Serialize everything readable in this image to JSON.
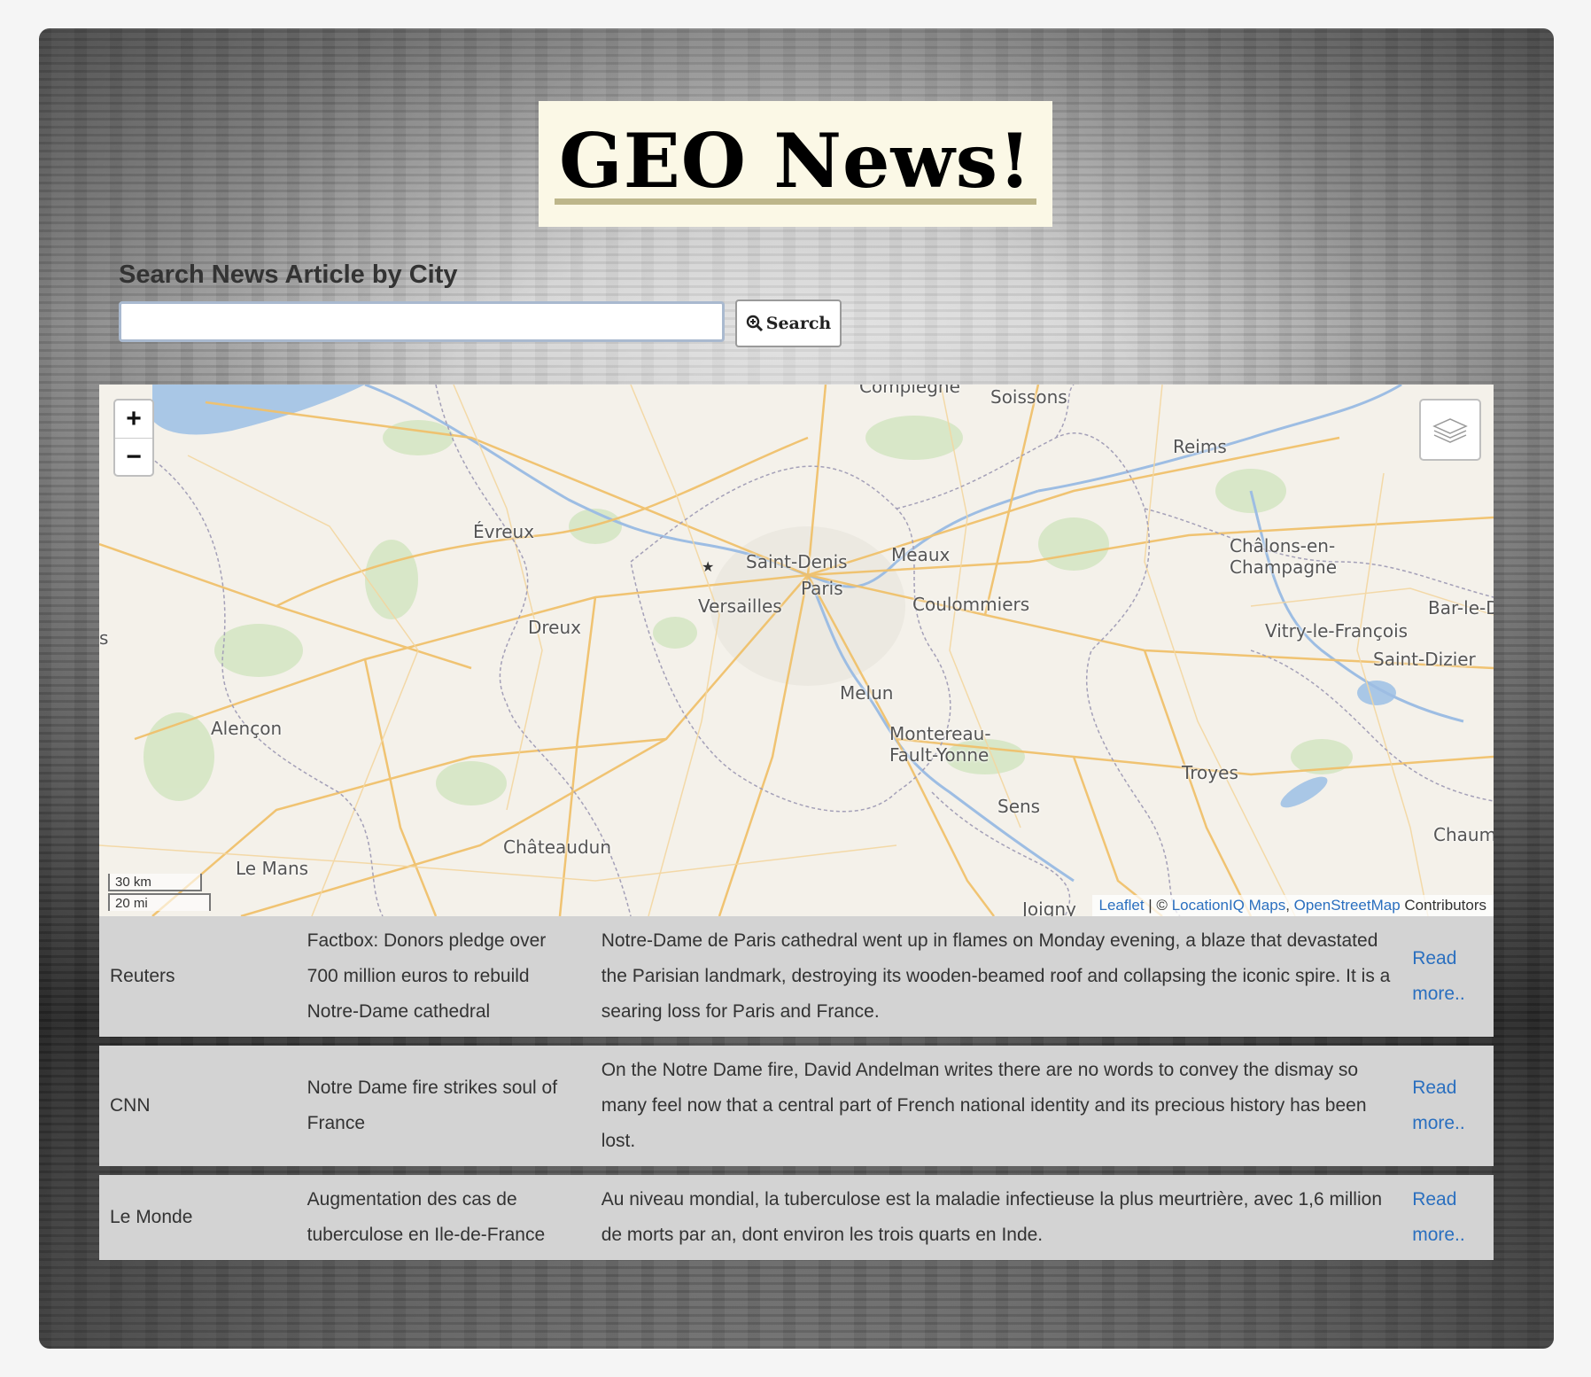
{
  "header": {
    "title": "GEO News!"
  },
  "search": {
    "label": "Search News Article by City",
    "value": "",
    "placeholder": "",
    "button_label": "Search"
  },
  "map": {
    "zoom_in": "+",
    "zoom_out": "−",
    "scale_km": "30 km",
    "scale_mi": "20 mi",
    "attribution": {
      "leaflet": "Leaflet",
      "separator": " | © ",
      "locationiq": "LocationIQ Maps",
      "comma": ", ",
      "osm": "OpenStreetMap",
      "contributors": " Contributors"
    },
    "places": [
      "Compiègne",
      "Soissons",
      "Reims",
      "Évreux",
      "Saint-Denis",
      "Meaux",
      "Paris",
      "Versailles",
      "Coulommiers",
      "Châlons-en-",
      "Champagne",
      "Dreux",
      "Vitry-le-François",
      "Bar-le-D",
      "Saint-Dizier",
      "Melun",
      "Alençon",
      "Montereau-",
      "Fault-Yonne",
      "Troyes",
      "Sens",
      "Châteaudun",
      "Le Mans",
      "Joigny",
      "Chaumo",
      "s"
    ]
  },
  "articles": [
    {
      "source": "Reuters",
      "title": "Factbox: Donors pledge over 700 million euros to rebuild Notre-Dame cathedral",
      "description": "Notre-Dame de Paris cathedral went up in flames on Monday evening, a blaze that devastated the Parisian landmark, destroying its wooden-beamed roof and collapsing the iconic spire. It is a searing loss for Paris and France.",
      "link": "Read more.."
    },
    {
      "source": "CNN",
      "title": "Notre Dame fire strikes soul of France",
      "description": "On the Notre Dame fire, David Andelman writes there are no words to convey the dismay so many feel now that a central part of French national identity and its precious history has been lost.",
      "link": "Read more.."
    },
    {
      "source": "Le Monde",
      "title": "Augmentation des cas de tuberculose en Ile-de-France",
      "description": "Au niveau mondial, la tuberculose est la maladie infectieuse la plus meurtrière, avec 1,6 million de morts par an, dont environ les trois quarts en Inde.",
      "link": "Read more.."
    }
  ]
}
